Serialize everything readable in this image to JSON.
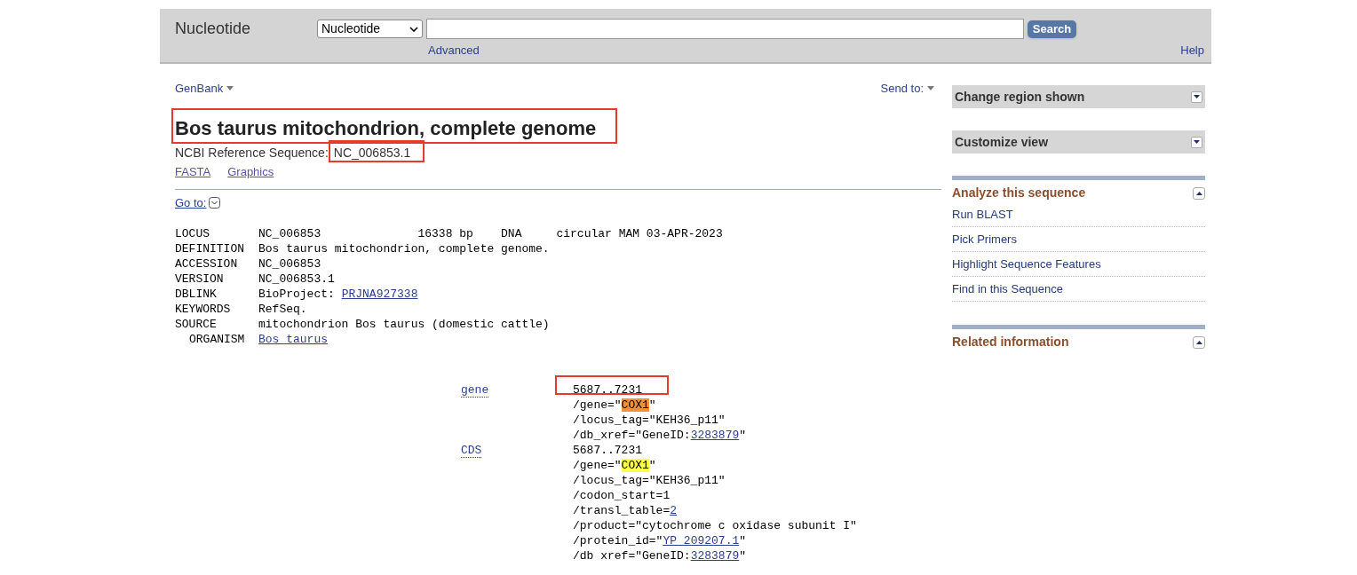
{
  "header": {
    "title": "Nucleotide",
    "database": "Nucleotide",
    "search_button": "Search",
    "advanced": "Advanced",
    "help": "Help"
  },
  "record": {
    "format": "GenBank",
    "send_to": "Send to:",
    "title": {
      "text": "Bos taurus mitochondrion, complete genome",
      "annotated": true
    },
    "refseq_label": "NCBI Reference Sequence:",
    "refseq_id": {
      "text": "NC_006853.1",
      "annotated": true
    },
    "links": [
      "FASTA",
      "Graphics"
    ],
    "goto": "Go to:",
    "lines": [
      {
        "key": "LOCUS",
        "parts": [
          {
            "kind": "text",
            "text": "NC_006853              16338 bp    DNA     circular MAM 03-APR-2023"
          }
        ]
      },
      {
        "key": "DEFINITION",
        "parts": [
          {
            "kind": "text",
            "text": "Bos taurus mitochondrion, complete genome."
          }
        ]
      },
      {
        "key": "ACCESSION",
        "parts": [
          {
            "kind": "text",
            "text": "NC_006853"
          }
        ]
      },
      {
        "key": "VERSION",
        "parts": [
          {
            "kind": "text",
            "text": "NC_006853.1"
          }
        ]
      },
      {
        "key": "DBLINK",
        "parts": [
          {
            "kind": "text",
            "text": "BioProject: "
          },
          {
            "kind": "link",
            "text": "PRJNA927338"
          }
        ]
      },
      {
        "key": "KEYWORDS",
        "parts": [
          {
            "kind": "text",
            "text": "RefSeq."
          }
        ]
      },
      {
        "key": "SOURCE",
        "parts": [
          {
            "kind": "text",
            "text": "mitochondrion Bos taurus (domestic cattle)"
          }
        ]
      },
      {
        "key": "ORGANISM",
        "parts": [
          {
            "kind": "link",
            "text": "Bos taurus"
          }
        ]
      }
    ]
  },
  "sidebar": [
    {
      "title": "Change region shown",
      "expanded": false
    },
    {
      "title": "Customize view",
      "expanded": false
    },
    {
      "title": "Analyze this sequence",
      "expanded": true,
      "items": [
        "Run BLAST",
        "Pick Primers",
        "Highlight Sequence Features",
        "Find in this Sequence"
      ]
    },
    {
      "title": "Related information",
      "expanded": true
    }
  ],
  "features": [
    {
      "key": "gene",
      "lines": [
        {
          "annotated": true,
          "parts": [
            {
              "kind": "text",
              "text": "5687..7231"
            }
          ]
        },
        {
          "annotated": false,
          "parts": [
            {
              "kind": "text",
              "text": "/gene=\""
            },
            {
              "kind": "highlight",
              "color": "#f0923a",
              "text": "COX1"
            },
            {
              "kind": "text",
              "text": "\""
            }
          ]
        },
        {
          "annotated": false,
          "parts": [
            {
              "kind": "text",
              "text": "/locus_tag=\"KEH36_p11\""
            }
          ]
        },
        {
          "annotated": false,
          "parts": [
            {
              "kind": "text",
              "text": "/db_xref=\"GeneID:"
            },
            {
              "kind": "link",
              "text": "3283879"
            },
            {
              "kind": "text",
              "text": "\""
            }
          ]
        }
      ]
    },
    {
      "key": "CDS",
      "lines": [
        {
          "annotated": false,
          "parts": [
            {
              "kind": "text",
              "text": "5687..7231"
            }
          ]
        },
        {
          "annotated": false,
          "parts": [
            {
              "kind": "text",
              "text": "/gene=\""
            },
            {
              "kind": "highlight",
              "color": "#ffff4d",
              "text": "COX1"
            },
            {
              "kind": "text",
              "text": "\""
            }
          ]
        },
        {
          "annotated": false,
          "parts": [
            {
              "kind": "text",
              "text": "/locus_tag=\"KEH36_p11\""
            }
          ]
        },
        {
          "annotated": false,
          "parts": [
            {
              "kind": "text",
              "text": "/codon_start=1"
            }
          ]
        },
        {
          "annotated": false,
          "parts": [
            {
              "kind": "text",
              "text": "/transl_table="
            },
            {
              "kind": "link",
              "text": "2"
            }
          ]
        },
        {
          "annotated": false,
          "parts": [
            {
              "kind": "text",
              "text": "/product=\"cytochrome c oxidase subunit I\""
            }
          ]
        },
        {
          "annotated": false,
          "parts": [
            {
              "kind": "text",
              "text": "/protein_id=\""
            },
            {
              "kind": "link",
              "text": "YP_209207.1"
            },
            {
              "kind": "text",
              "text": "\""
            }
          ]
        },
        {
          "annotated": false,
          "parts": [
            {
              "kind": "text",
              "text": "/db xref=\"GeneID:"
            },
            {
              "kind": "link",
              "text": "3283879"
            },
            {
              "kind": "text",
              "text": "\""
            }
          ]
        }
      ]
    }
  ]
}
